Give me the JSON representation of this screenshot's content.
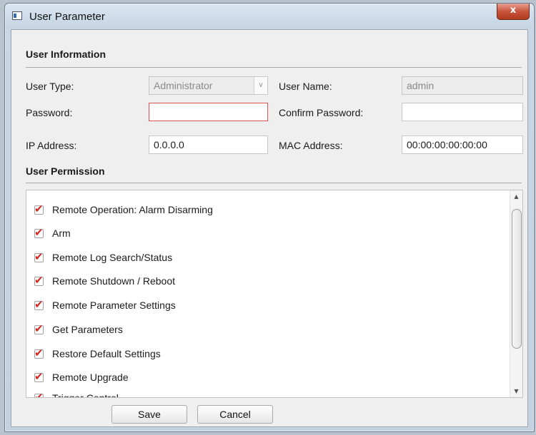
{
  "window": {
    "title": "User Parameter",
    "close_glyph": "x"
  },
  "user_info": {
    "heading": "User Information",
    "user_type": {
      "label": "User Type:",
      "value": "Administrator"
    },
    "user_name": {
      "label": "User Name:",
      "value": "admin"
    },
    "password": {
      "label": "Password:",
      "value": ""
    },
    "confirm_password": {
      "label": "Confirm Password:",
      "value": ""
    },
    "ip_address": {
      "label": "IP Address:",
      "value": "0.0.0.0"
    },
    "mac_address": {
      "label": "MAC Address:",
      "value": "00:00:00:00:00:00"
    }
  },
  "permission": {
    "heading": "User Permission",
    "items": [
      {
        "label": "Remote Operation: Alarm Disarming",
        "checked": true
      },
      {
        "label": "Arm",
        "checked": true
      },
      {
        "label": "Remote Log Search/Status",
        "checked": true
      },
      {
        "label": "Remote Shutdown / Reboot",
        "checked": true
      },
      {
        "label": "Remote Parameter Settings",
        "checked": true
      },
      {
        "label": "Get Parameters",
        "checked": true
      },
      {
        "label": "Restore Default Settings",
        "checked": true
      },
      {
        "label": "Remote Upgrade",
        "checked": true
      },
      {
        "label": "Trigger Control",
        "checked": true
      }
    ]
  },
  "buttons": {
    "save": "Save",
    "cancel": "Cancel"
  },
  "colors": {
    "checkmark": "#d0261d",
    "error_border": "#d9534f"
  },
  "icons": {
    "window": "app-window-icon",
    "close": "close-icon",
    "check": "checkmark-icon",
    "combo": "chevron-down-icon"
  }
}
